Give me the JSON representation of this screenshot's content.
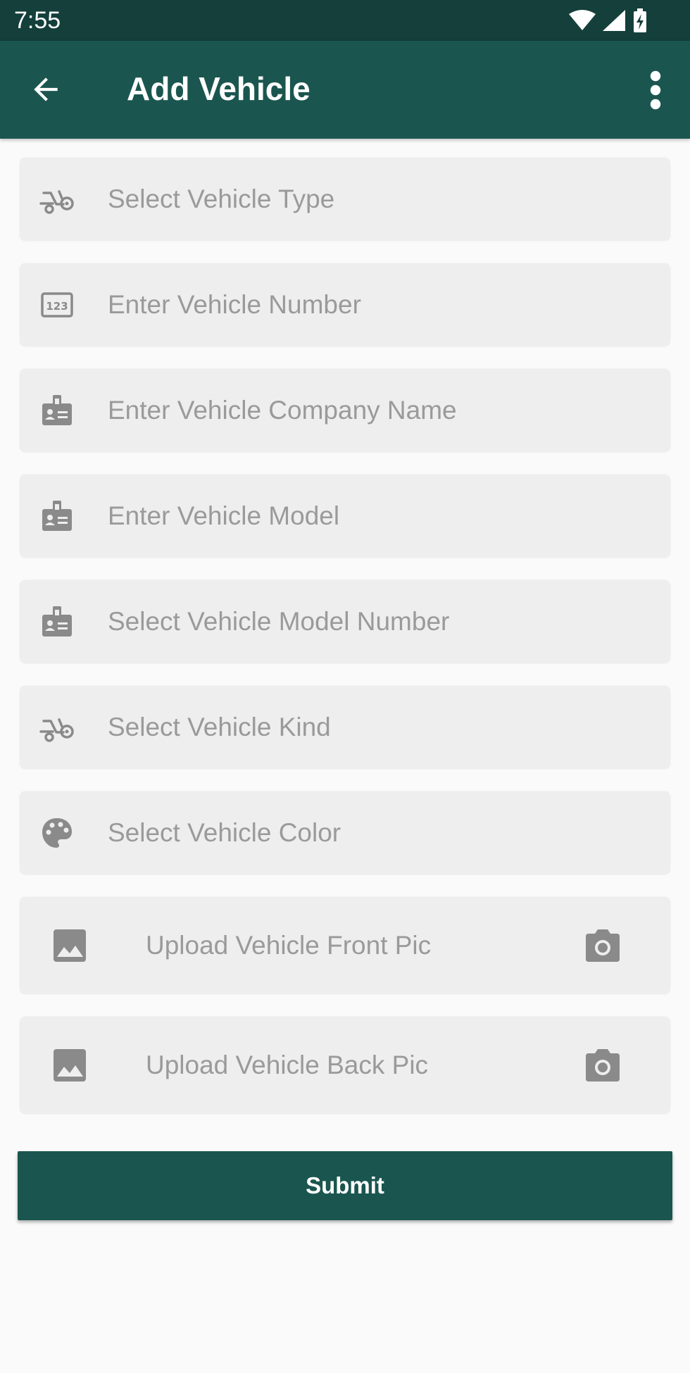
{
  "status_bar": {
    "time": "7:55"
  },
  "app_bar": {
    "title": "Add Vehicle",
    "back_icon": "arrow-back-icon",
    "menu_icon": "more-vert-icon"
  },
  "form": {
    "fields": [
      {
        "label": "Select Vehicle Type",
        "icon": "bike-icon"
      },
      {
        "label": "Enter Vehicle Number",
        "icon": "number-123-icon"
      },
      {
        "label": "Enter Vehicle Company Name",
        "icon": "id-badge-icon"
      },
      {
        "label": "Enter Vehicle Model",
        "icon": "id-badge-icon"
      },
      {
        "label": "Select Vehicle Model Number",
        "icon": "id-badge-icon"
      },
      {
        "label": "Select Vehicle Kind",
        "icon": "bike-icon"
      },
      {
        "label": "Select Vehicle Color",
        "icon": "palette-icon"
      }
    ],
    "uploads": [
      {
        "label": "Upload Vehicle Front Pic",
        "icon": "image-icon",
        "action_icon": "camera-icon"
      },
      {
        "label": "Upload Vehicle Back Pic",
        "icon": "image-icon",
        "action_icon": "camera-icon"
      }
    ],
    "submit_label": "Submit"
  },
  "colors": {
    "status_bar": "#143f3b",
    "primary": "#1a564f",
    "field_background": "#eeeeee",
    "hint_text": "#9a9a9a",
    "icon": "#8a8a8a"
  }
}
